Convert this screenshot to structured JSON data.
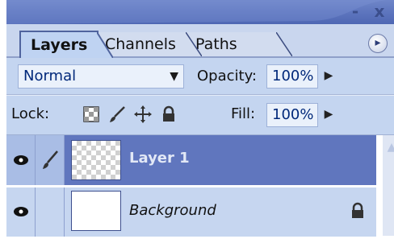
{
  "window": {
    "minimize": "-",
    "close": "x"
  },
  "tabs": [
    {
      "label": "Layers",
      "active": true
    },
    {
      "label": "Channels",
      "active": false
    },
    {
      "label": "Paths",
      "active": false
    }
  ],
  "panel_menu_icon": "right-arrow-circle-icon",
  "blend": {
    "mode": "Normal",
    "opacity_label": "Opacity:",
    "opacity_value": "100%"
  },
  "lock": {
    "label": "Lock:",
    "fill_label": "Fill:",
    "fill_value": "100%",
    "icons": [
      "lock-transparency-icon",
      "lock-paint-brush-icon",
      "lock-move-icon",
      "lock-all-icon"
    ]
  },
  "layers": [
    {
      "name": "Layer 1",
      "selected": true,
      "visible": true,
      "linked_icon": "brush-icon",
      "thumbnail": "transparent"
    },
    {
      "name": "Background",
      "selected": false,
      "visible": true,
      "locked": true,
      "thumbnail": "white"
    }
  ],
  "colors": {
    "selection": "#6076be",
    "panel": "#c4d5f0",
    "title_bar": "#5c74bd"
  }
}
